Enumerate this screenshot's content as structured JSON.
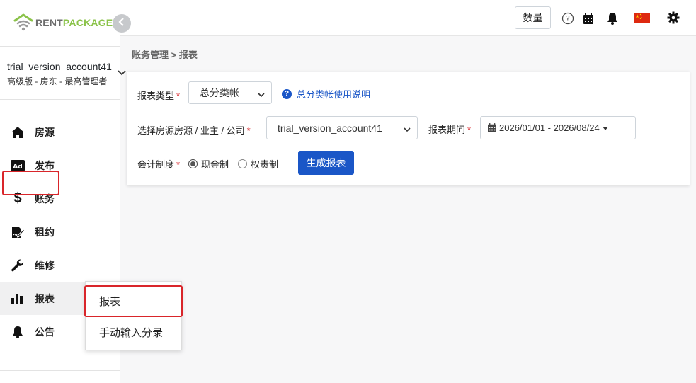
{
  "brand": {
    "name_part1": "RENT",
    "name_part2": "PACKAGE"
  },
  "account": {
    "name": "trial_version_account41",
    "role": "高级版 - 房东 - 最高管理者"
  },
  "sidebar": {
    "items": [
      {
        "label": "房源",
        "icon": "home-icon"
      },
      {
        "label": "发布",
        "icon": "ad-icon"
      },
      {
        "label": "账务",
        "icon": "dollar-icon"
      },
      {
        "label": "租约",
        "icon": "contract-icon"
      },
      {
        "label": "维修",
        "icon": "wrench-icon"
      },
      {
        "label": "报表",
        "icon": "bar-chart-icon"
      },
      {
        "label": "公告",
        "icon": "bell-icon"
      }
    ]
  },
  "submenu": {
    "items": [
      "报表",
      "手动输入分录"
    ]
  },
  "topbar": {
    "qty_label": "数量"
  },
  "breadcrumb": "账务管理 > 报表",
  "form": {
    "report_type_label": "报表类型",
    "report_type_value": "总分类帐",
    "help_link": "总分类帐使用说明",
    "property_label": "选择房源房源 / 业主 / 公司",
    "property_value": "trial_version_account41",
    "period_label": "报表期间",
    "period_value": "2026/01/01 - 2026/08/24",
    "accounting_label": "会计制度",
    "accounting_options": [
      "现金制",
      "权责制"
    ],
    "generate_button": "生成报表",
    "required_mark": "*"
  },
  "colors": {
    "primary": "#1a56c7",
    "highlight_red": "#d9252a",
    "brand_green": "#8bc34a"
  }
}
